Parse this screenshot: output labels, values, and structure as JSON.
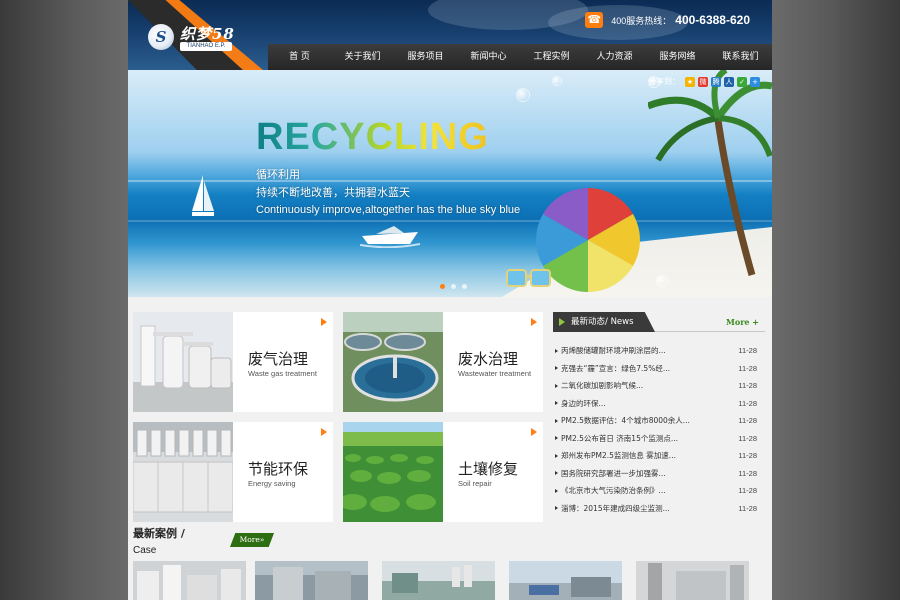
{
  "header": {
    "logo_text": "织梦58",
    "logo_sub": "TIANHAO E.P.",
    "logo_mark": "S",
    "hotline_label": "400服务热线：",
    "hotline_number": "400-6388-620",
    "phone_icon": "phone-icon",
    "nav": [
      {
        "label": "首 页"
      },
      {
        "label": "关于我们"
      },
      {
        "label": "服务项目"
      },
      {
        "label": "新闻中心"
      },
      {
        "label": "工程实例"
      },
      {
        "label": "人力资源"
      },
      {
        "label": "服务网络"
      },
      {
        "label": "联系我们"
      }
    ]
  },
  "banner": {
    "title": "RECYCLING",
    "line1": "循环利用",
    "line2": "持续不断地改善，共拥碧水蓝天",
    "line3": "Continuously improve,altogether has the blue sky blue",
    "share_label": "分享到：",
    "share_icons": [
      {
        "name": "qzone-icon",
        "color": "#f5b400"
      },
      {
        "name": "weibo-icon",
        "color": "#e23a2e"
      },
      {
        "name": "tencent-weibo-icon",
        "color": "#2a7fc1"
      },
      {
        "name": "renren-icon",
        "color": "#1f61a8"
      },
      {
        "name": "wechat-icon",
        "color": "#3aa93a"
      },
      {
        "name": "more-share-icon",
        "color": "#2e8de0"
      }
    ]
  },
  "services": [
    {
      "title": "废气治理",
      "sub": "Waste gas treatment"
    },
    {
      "title": "废水治理",
      "sub": "Wastewater treatment"
    },
    {
      "title": "节能环保",
      "sub": "Energy saving"
    },
    {
      "title": "土壤修复",
      "sub": "Soil repair"
    }
  ],
  "news": {
    "heading": "最新动态/ News",
    "more": "More +",
    "items": [
      {
        "title": "丙烯酸储罐耐环境冲刷涂层的...",
        "date": "11-28"
      },
      {
        "title": "克强去“霾”宣言：绿色7.5%经...",
        "date": "11-28"
      },
      {
        "title": "二氧化碳加剧影响气候...",
        "date": "11-28"
      },
      {
        "title": "身边的环保...",
        "date": "11-28"
      },
      {
        "title": "PM2.5数据评估：4个城市8000余人...",
        "date": "11-28"
      },
      {
        "title": "PM2.5公布首日 济南15个监测点...",
        "date": "11-28"
      },
      {
        "title": "郑州发布PM2.5监测信息 雾加速...",
        "date": "11-28"
      },
      {
        "title": "国务院研究部署进一步加强雾...",
        "date": "11-28"
      },
      {
        "title": "《北京市大气污染防治条例》...",
        "date": "11-28"
      },
      {
        "title": "淄博：2015年建成四级尘监测...",
        "date": "11-28"
      }
    ]
  },
  "cases": {
    "title": "最新案例 /",
    "sub": "Case",
    "more": "More»"
  }
}
